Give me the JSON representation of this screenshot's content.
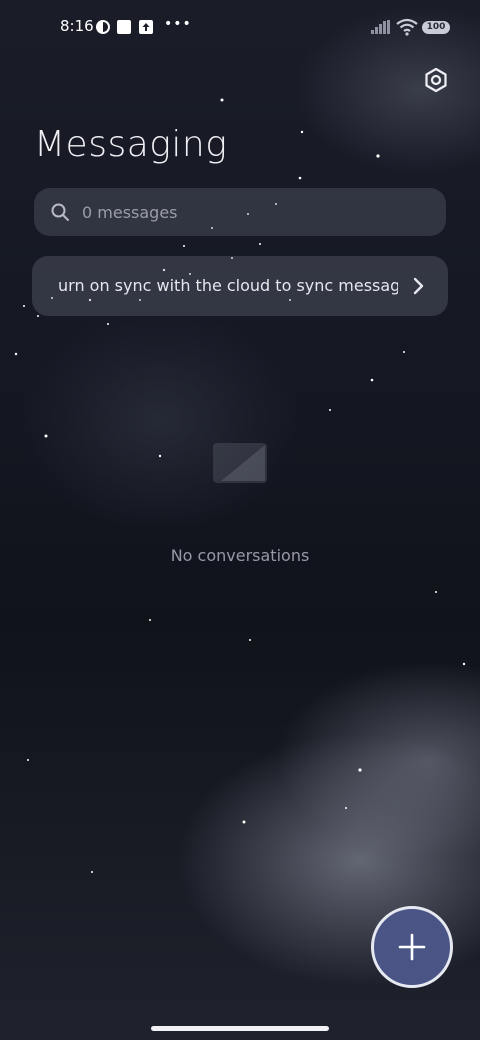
{
  "status_bar": {
    "time": "8:16",
    "more": "•••",
    "battery": "100"
  },
  "header": {
    "title": "Messaging",
    "settings_icon": "settings-gear-icon"
  },
  "search": {
    "placeholder": "0 messages"
  },
  "sync_banner": {
    "text": "urn on sync with the cloud to sync messag"
  },
  "empty_state": {
    "message": "No conversations"
  },
  "fab": {
    "icon": "plus-icon"
  },
  "colors": {
    "fab_bg": "#4a5585",
    "fab_border": "#e6e8f2",
    "card_bg": "rgba(120,124,140,0.28)"
  }
}
